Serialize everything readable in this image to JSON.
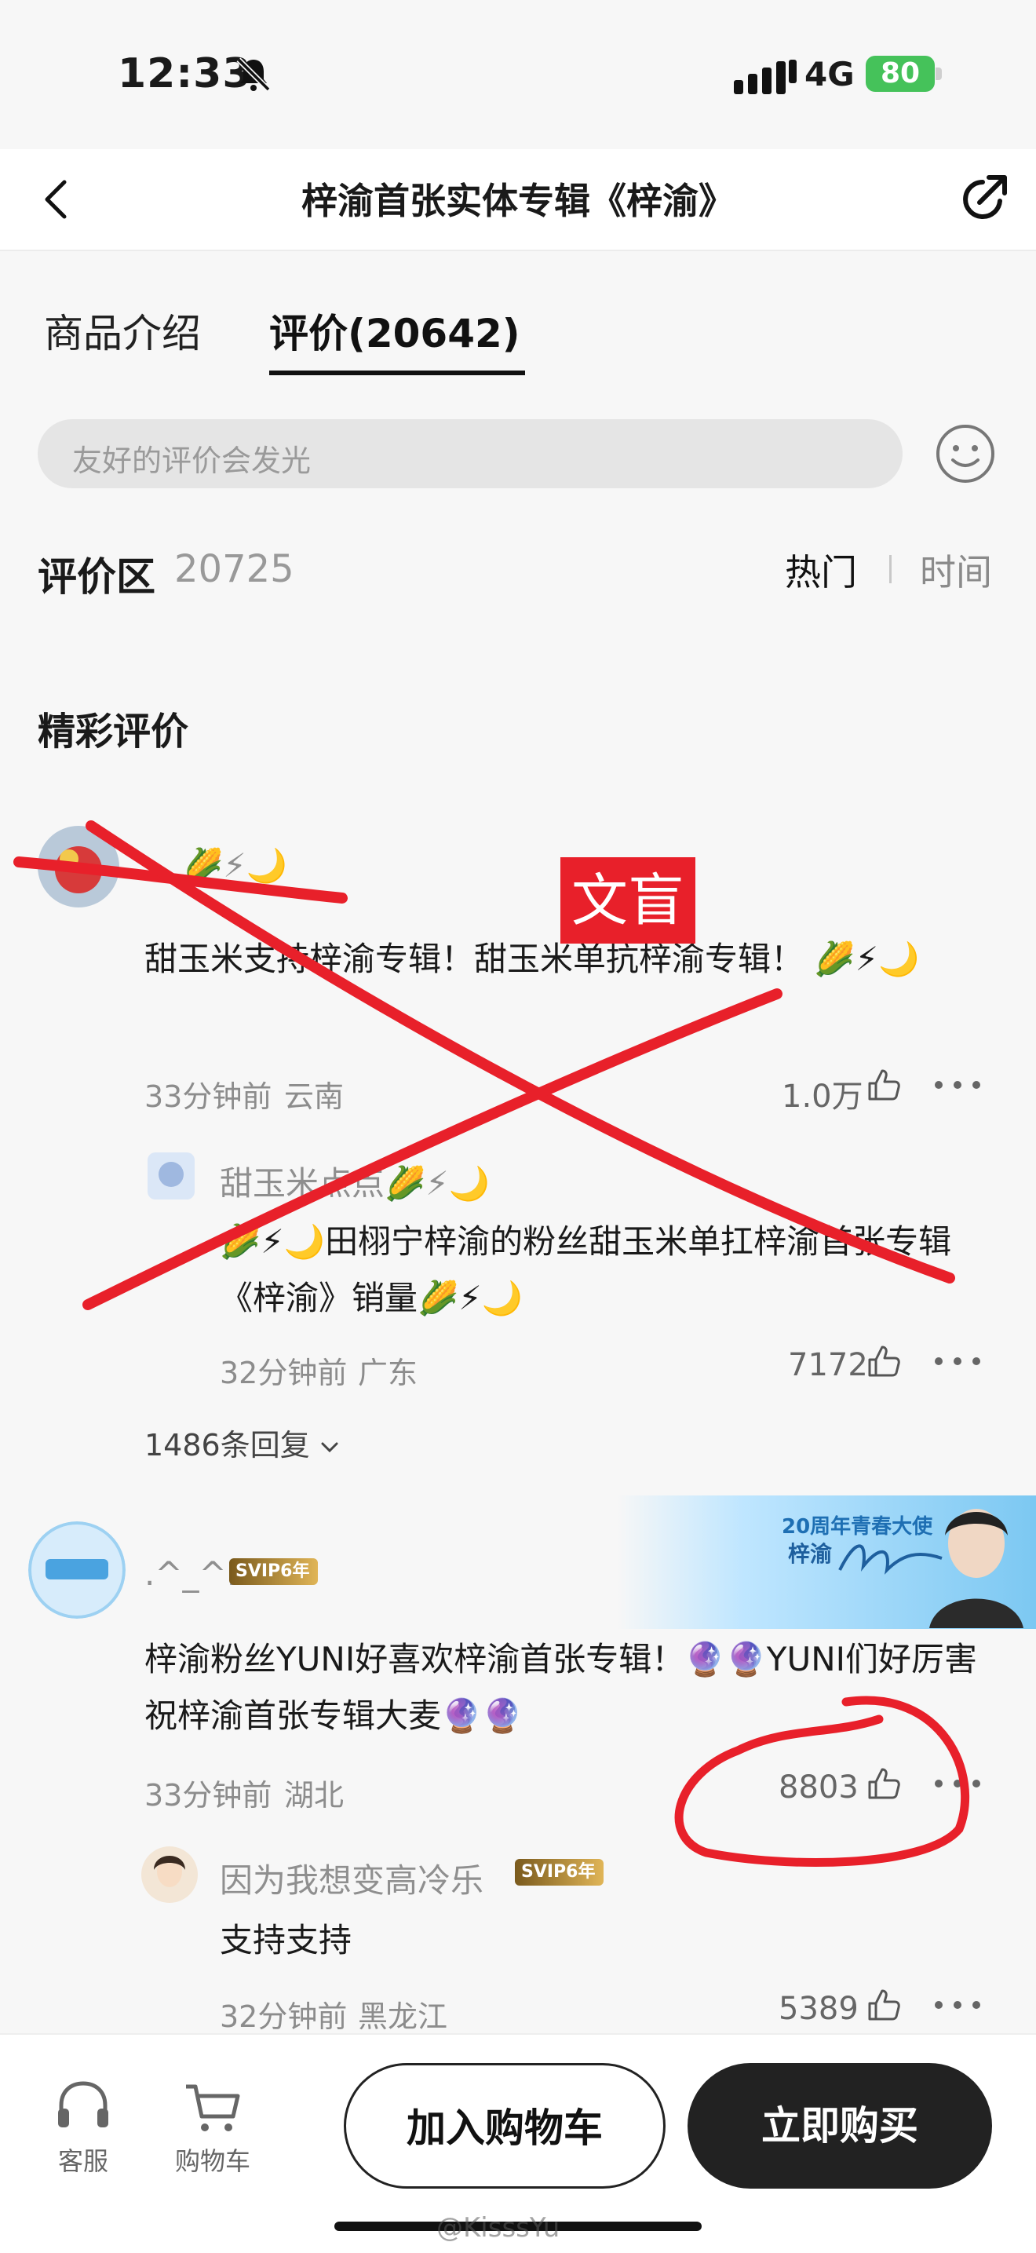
{
  "status_bar": {
    "time": "12:33",
    "network": "4G",
    "battery": "80"
  },
  "nav": {
    "title": "梓渝首张实体专辑《梓渝》"
  },
  "tabs": {
    "intro": "商品介绍",
    "reviews": "评价(20642)"
  },
  "comment_input": {
    "placeholder": "友好的评价会发光"
  },
  "section": {
    "title": "评价区",
    "count": "20725",
    "sort_hot": "热门",
    "sort_time": "时间",
    "featured": "精彩评价"
  },
  "comments": [
    {
      "name": "🌽⚡🌙",
      "text": "甜玉米支持梓渝专辑！甜玉米单抗梓渝专辑！ 🌽⚡🌙",
      "time": "33分钟前",
      "location": "云南",
      "likes": "1.0万",
      "reply": {
        "name": "甜玉米点点🌽⚡🌙",
        "text": "🌽⚡🌙田栩宁梓渝的粉丝甜玉米单扛梓渝首张专辑《梓渝》销量🌽⚡🌙",
        "time": "32分钟前",
        "location": "广东",
        "likes": "7172"
      },
      "replies_count": "1486条回复"
    },
    {
      "name": ".^_^.",
      "vip": "SVIP6年",
      "text": "梓渝粉丝YUNI好喜欢梓渝首张专辑！🔮🔮YUNI们好厉害祝梓渝首张专辑大麦🔮🔮",
      "time": "33分钟前",
      "location": "湖北",
      "likes": "8803",
      "reply": {
        "name": "因为我想变高冷乐",
        "vip": "SVIP6年",
        "text": "支持支持",
        "time": "32分钟前",
        "location": "黑龙江",
        "likes": "5389"
      }
    }
  ],
  "banner": {
    "line1": "20周年青春大使",
    "line2": "梓渝"
  },
  "bottom_bar": {
    "service": "客服",
    "cart": "购物车",
    "add_to_cart": "加入购物车",
    "buy_now": "立即购买"
  },
  "annotation": {
    "stamp": "文盲"
  },
  "watermark": "@KisssYu",
  "colors": {
    "accent": "#222222",
    "annotation_red": "#e8202a",
    "battery": "#45c25a"
  }
}
